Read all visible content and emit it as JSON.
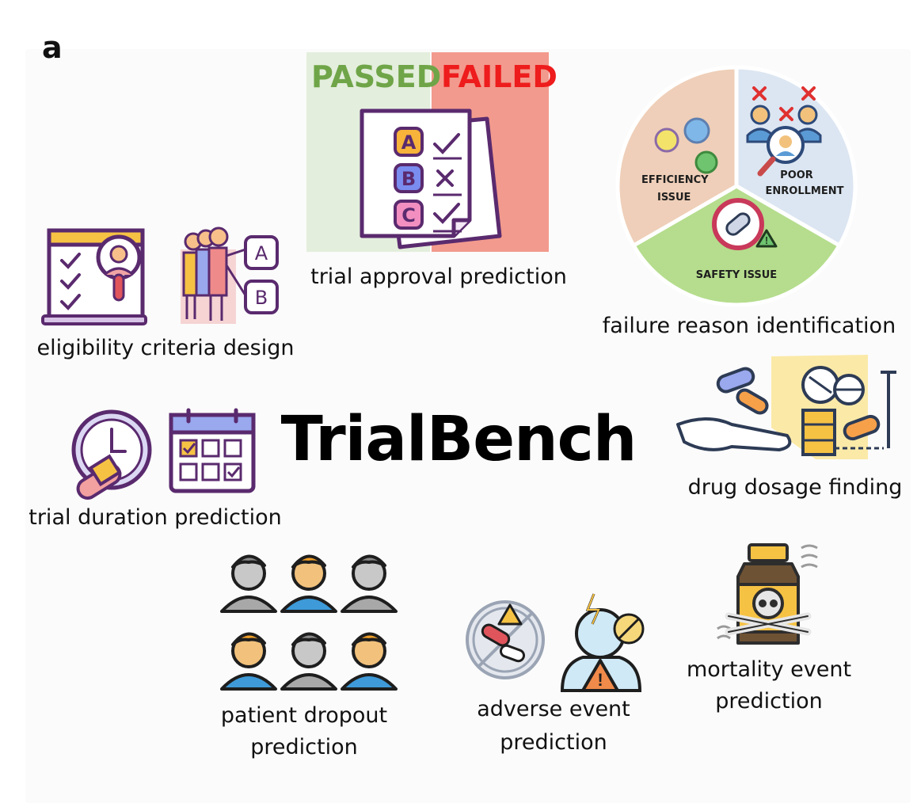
{
  "panel_label": "a",
  "title": "TrialBench",
  "approval": {
    "passed": "PASSED",
    "failed": "FAILED",
    "options": [
      "A",
      "B",
      "C"
    ],
    "caption": "trial approval prediction",
    "colors": {
      "passed": "#6fa548",
      "failed": "#ee1c1c",
      "passed_bg": "#e3eedc",
      "failed_bg": "#f29a8d"
    }
  },
  "failure_reason": {
    "segments": [
      {
        "label_line1": "EFFICIENCY",
        "label_line2": "ISSUE",
        "color": "#efcfb9"
      },
      {
        "label_line1": "POOR",
        "label_line2": "ENROLLMENT",
        "color": "#dce6f2"
      },
      {
        "label_line1": "SAFETY ISSUE",
        "label_line2": "",
        "color": "#b5dd8d"
      }
    ],
    "caption": "failure reason identification"
  },
  "eligibility": {
    "options": [
      "A",
      "B"
    ],
    "caption": "eligibility criteria design"
  },
  "duration": {
    "caption": "trial duration prediction"
  },
  "dosage": {
    "caption": "drug dosage finding"
  },
  "dropout": {
    "caption_line1": "patient dropout",
    "caption_line2": "prediction"
  },
  "adverse": {
    "caption_line1": "adverse event",
    "caption_line2": "prediction"
  },
  "mortality": {
    "caption_line1": "mortality event",
    "caption_line2": "prediction"
  }
}
